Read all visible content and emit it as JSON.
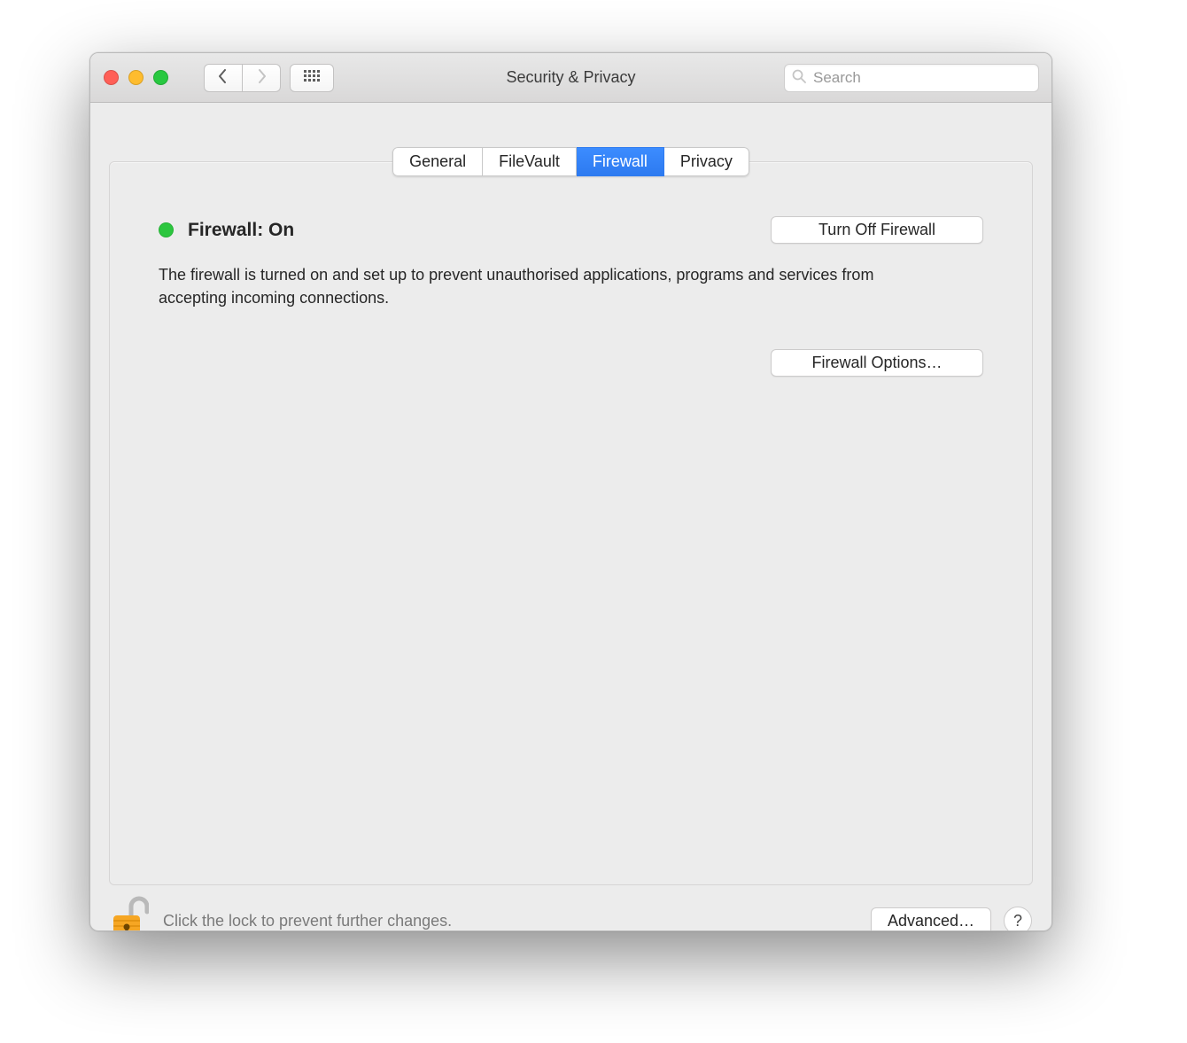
{
  "window": {
    "title": "Security & Privacy"
  },
  "search": {
    "placeholder": "Search"
  },
  "tabs": [
    {
      "label": "General",
      "active": false
    },
    {
      "label": "FileVault",
      "active": false
    },
    {
      "label": "Firewall",
      "active": true
    },
    {
      "label": "Privacy",
      "active": false
    }
  ],
  "firewall": {
    "status_label": "Firewall: On",
    "status_color": "#2cc63e",
    "toggle_button": "Turn Off Firewall",
    "description": "The firewall is turned on and set up to prevent unauthorised applications, programs and services from accepting incoming connections.",
    "options_button": "Firewall Options…"
  },
  "footer": {
    "lock_text": "Click the lock to prevent further changes.",
    "advanced_button": "Advanced…",
    "help_label": "?"
  }
}
